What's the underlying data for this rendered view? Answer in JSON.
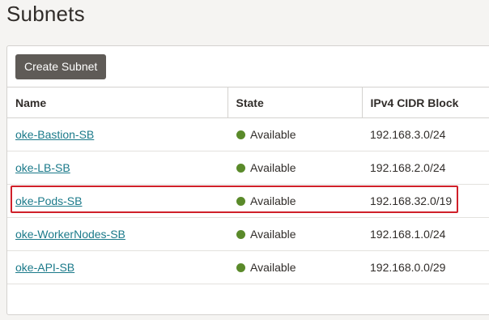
{
  "page": {
    "title": "Subnets"
  },
  "toolbar": {
    "create_label": "Create Subnet"
  },
  "table": {
    "columns": [
      "Name",
      "State",
      "IPv4 CIDR Block"
    ],
    "rows": [
      {
        "name": "oke-Bastion-SB",
        "state": "Available",
        "cidr": "192.168.3.0/24"
      },
      {
        "name": "oke-LB-SB",
        "state": "Available",
        "cidr": "192.168.2.0/24"
      },
      {
        "name": "oke-Pods-SB",
        "state": "Available",
        "cidr": "192.168.32.0/19"
      },
      {
        "name": "oke-WorkerNodes-SB",
        "state": "Available",
        "cidr": "192.168.1.0/24"
      },
      {
        "name": "oke-API-SB",
        "state": "Available",
        "cidr": "192.168.0.0/29"
      }
    ]
  },
  "colors": {
    "link": "#1b7a8a",
    "status_available": "#5a8a2a",
    "highlight": "#d0202a",
    "button": "#5f5b57"
  },
  "icons": {
    "state": "status-dot-icon"
  }
}
